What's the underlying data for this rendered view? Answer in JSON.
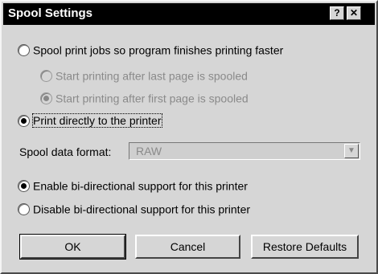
{
  "dialog": {
    "title": "Spool Settings",
    "help_button": "?",
    "close_button": "✕"
  },
  "options": {
    "spool": "Spool print jobs so program finishes printing faster",
    "start_after_last": "Start printing after last page is spooled",
    "start_after_first": "Start printing after first page is spooled",
    "print_direct": "Print directly to the printer"
  },
  "spool_format": {
    "label": "Spool data format:",
    "value": "RAW"
  },
  "bidi": {
    "enable": "Enable bi-directional support for this printer",
    "disable": "Disable bi-directional support for this printer"
  },
  "buttons": {
    "ok": "OK",
    "cancel": "Cancel",
    "restore": "Restore Defaults"
  }
}
